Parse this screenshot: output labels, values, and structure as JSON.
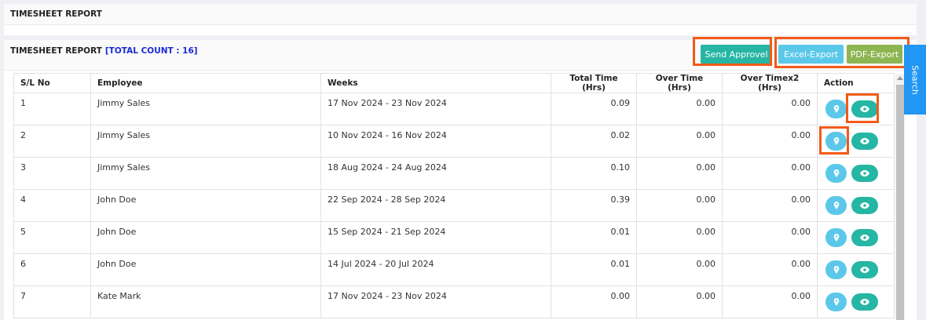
{
  "section_title": "TIMESHEET REPORT",
  "report": {
    "title": "TIMESHEET REPORT",
    "count_label": "[TOTAL COUNT : 16]"
  },
  "buttons": {
    "send_approval": "Send Approvel",
    "excel_export": "Excel-Export",
    "pdf_export": "PDF-Export"
  },
  "search_tab": "Search",
  "table": {
    "headers": [
      "S/L No",
      "Employee",
      "Weeks",
      "Total Time (Hrs)",
      "Over Time (Hrs)",
      "Over Timex2 (Hrs)",
      "Action"
    ],
    "rows": [
      {
        "sl": "1",
        "employee": "Jimmy Sales",
        "weeks": "17 Nov 2024 - 23 Nov 2024",
        "total": "0.09",
        "ot": "0.00",
        "ot2": "0.00"
      },
      {
        "sl": "2",
        "employee": "Jimmy Sales",
        "weeks": "10 Nov 2024 - 16 Nov 2024",
        "total": "0.02",
        "ot": "0.00",
        "ot2": "0.00"
      },
      {
        "sl": "3",
        "employee": "Jimmy Sales",
        "weeks": "18 Aug 2024 - 24 Aug 2024",
        "total": "0.10",
        "ot": "0.00",
        "ot2": "0.00"
      },
      {
        "sl": "4",
        "employee": "John Doe",
        "weeks": "22 Sep 2024 - 28 Sep 2024",
        "total": "0.39",
        "ot": "0.00",
        "ot2": "0.00"
      },
      {
        "sl": "5",
        "employee": "John Doe",
        "weeks": "15 Sep 2024 - 21 Sep 2024",
        "total": "0.01",
        "ot": "0.00",
        "ot2": "0.00"
      },
      {
        "sl": "6",
        "employee": "John Doe",
        "weeks": "14 Jul 2024 - 20 Jul 2024",
        "total": "0.01",
        "ot": "0.00",
        "ot2": "0.00"
      },
      {
        "sl": "7",
        "employee": "Kate Mark",
        "weeks": "17 Nov 2024 - 23 Nov 2024",
        "total": "0.00",
        "ot": "0.00",
        "ot2": "0.00"
      }
    ]
  },
  "colors": {
    "send": "#26b6a4",
    "excel": "#5bc8ea",
    "pdf": "#8db652",
    "highlight": "#f35a18",
    "count": "#1a2bd6",
    "search_tab": "#2196f3"
  },
  "icons": {
    "location": "map-pin-icon",
    "view": "eye-icon"
  }
}
